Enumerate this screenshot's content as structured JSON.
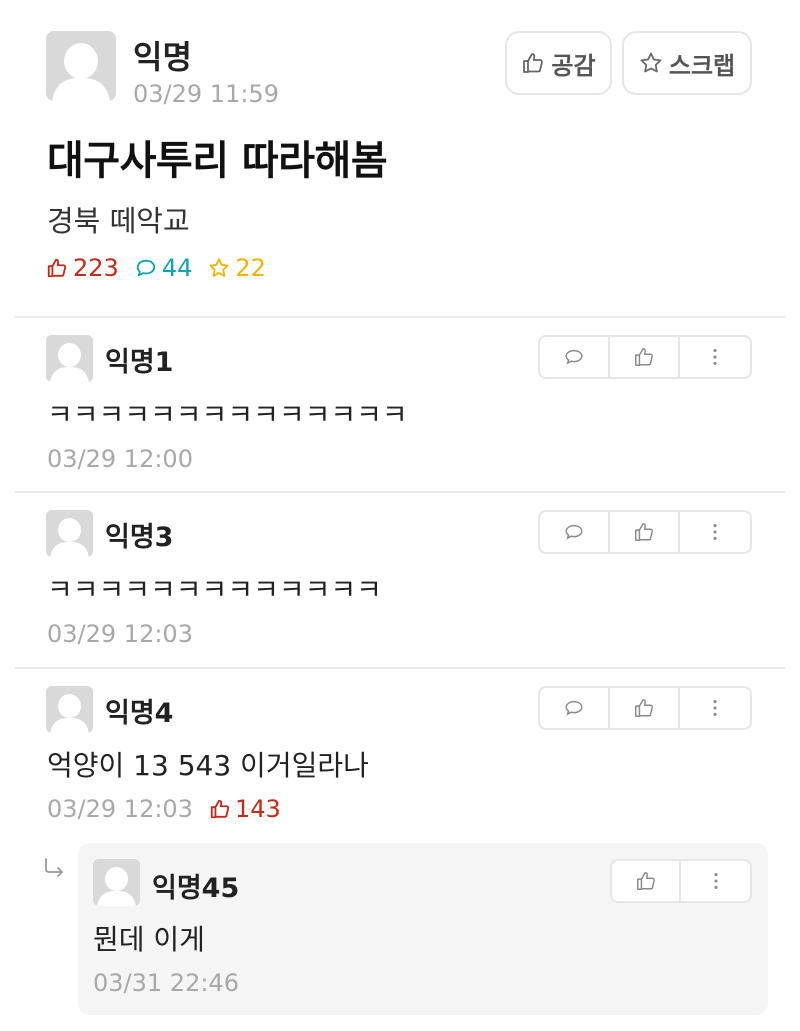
{
  "post": {
    "author": "익명",
    "time": "03/29 11:59",
    "title": "대구사투리 따라해봄",
    "body": "경북 떼악교",
    "like_button": "공감",
    "scrap_button": "스크랩",
    "stats": {
      "likes": "223",
      "comments": "44",
      "scraps": "22"
    }
  },
  "comments": [
    {
      "author": "익명1",
      "text": "ㅋㅋㅋㅋㅋㅋㅋㅋㅋㅋㅋㅋㅋㅋ",
      "time": "03/29 12:00"
    },
    {
      "author": "익명3",
      "text": "ㅋㅋㅋㅋㅋㅋㅋㅋㅋㅋㅋㅋㅋ",
      "time": "03/29 12:03"
    },
    {
      "author": "익명4",
      "text": "억양이 13 543 이거일라나",
      "time": "03/29 12:03",
      "votes": "143"
    }
  ],
  "reply": {
    "author": "익명45",
    "text": "뭔데 이게",
    "time": "03/31 22:46"
  },
  "colors": {
    "like": "#c62917",
    "comment": "#0ca5b0",
    "scrap": "#f0b400",
    "muted": "#a8a8a8"
  },
  "icons": [
    "thumbs-up-icon",
    "star-icon",
    "speech-bubble-icon",
    "more-vertical-icon",
    "reply-arrow-icon",
    "avatar-placeholder-icon"
  ]
}
